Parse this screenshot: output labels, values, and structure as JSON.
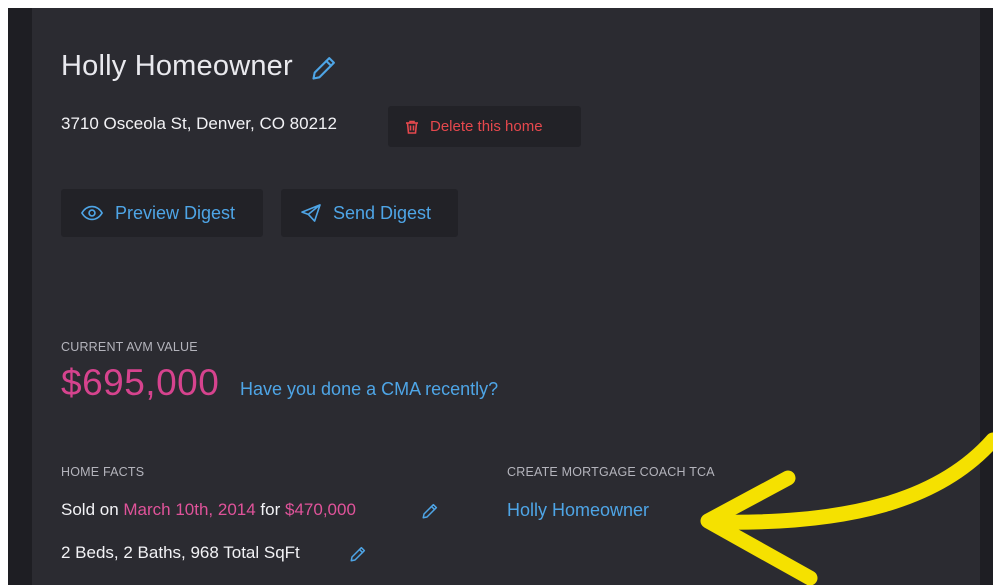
{
  "homeowner": {
    "name": "Holly Homeowner",
    "address": "3710 Osceola St, Denver, CO 80212",
    "delete_label": "Delete this home"
  },
  "actions": {
    "preview_label": "Preview Digest",
    "send_label": "Send Digest"
  },
  "avm": {
    "label": "CURRENT AVM VALUE",
    "value": "$695,000",
    "cma_link": "Have you done a CMA recently?"
  },
  "home_facts": {
    "label": "HOME FACTS",
    "sold_prefix": "Sold on ",
    "sold_date": "March 10th, 2014",
    "sold_mid": " for ",
    "sold_price": "$470,000",
    "summary": "2 Beds, 2 Baths, 968 Total SqFt"
  },
  "mortgage_coach": {
    "label": "CREATE MORTGAGE COACH TCA",
    "link": "Holly Homeowner"
  },
  "colors": {
    "panel_bg": "#2b2b31",
    "link_blue": "#4ea5e6",
    "accent_pink": "#d6438e",
    "danger_red": "#e5484d",
    "annotation_yellow": "#f5e100"
  },
  "icons": {
    "edit": "pencil-icon",
    "delete": "trash-icon",
    "preview": "eye-icon",
    "send": "paper-plane-icon"
  }
}
